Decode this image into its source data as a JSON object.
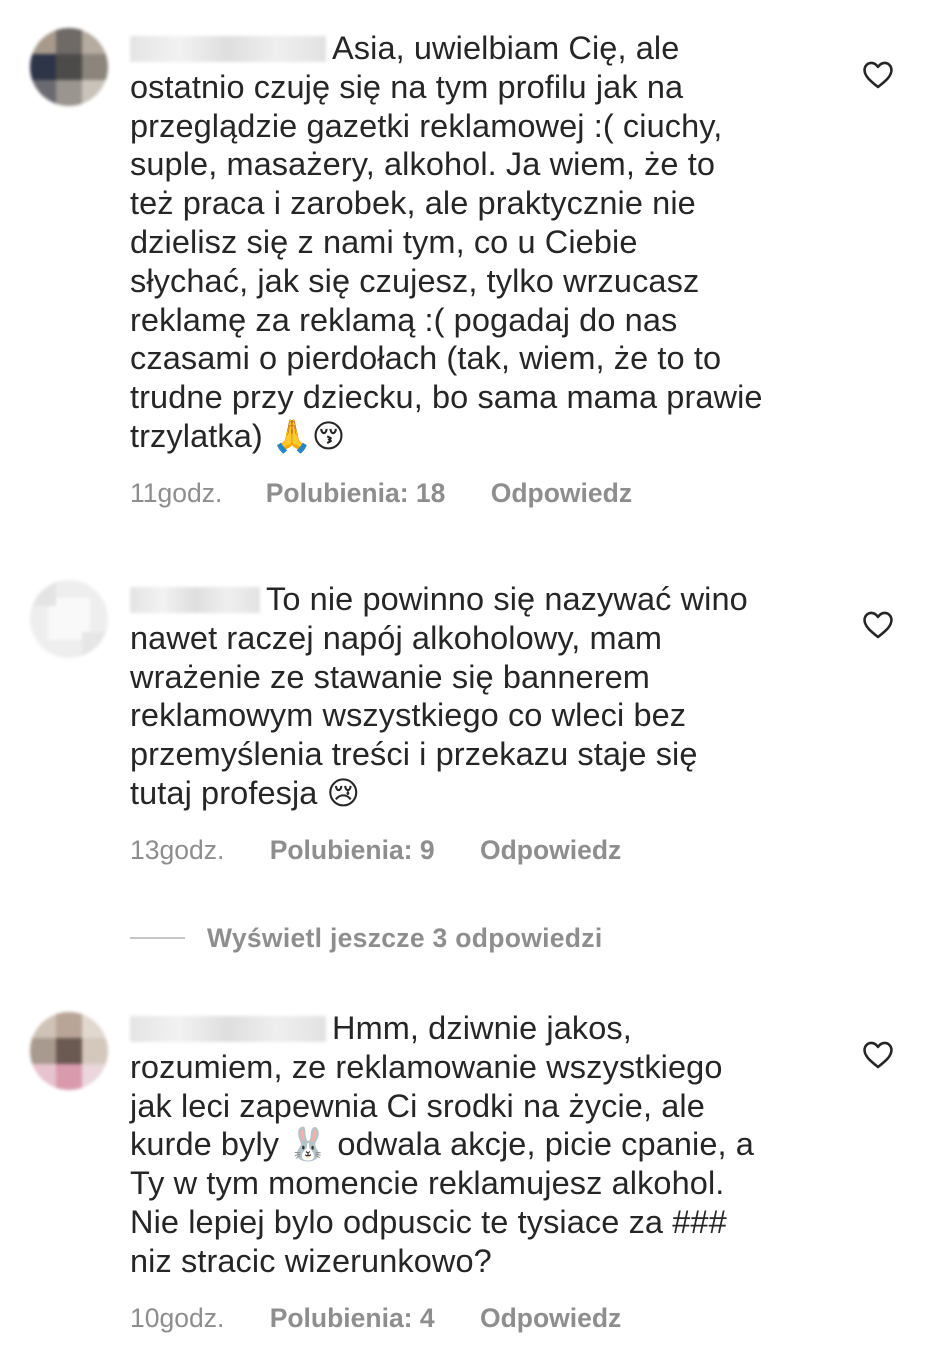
{
  "comments": [
    {
      "text": "Asia, uwielbiam Cię, ale\nostatnio czuję się na tym profilu jak na\nprzeglądzie gazetki reklamowej :( ciuchy,\nsuple, masażery, alkohol. Ja wiem, że to\nteż praca i zarobek, ale praktycznie nie\ndzielisz się z nami tym, co u Ciebie\nsłychać, jak się czujesz, tylko wrzucasz\nreklamę za reklamą :( pogadaj do nas\nczasami o pierdołach (tak, wiem, że to to\ntrudne przy dziecku, bo sama mama prawie\ntrzylatka) ",
      "emoji1": "🙏",
      "emoji2": "😚",
      "time": "11godz.",
      "likes": "Polubienia: 18",
      "reply": "Odpowiedz"
    },
    {
      "text": "To nie powinno się nazywać wino\nnawet raczej napój alkoholowy, mam\nwrażenie ze stawanie się bannerem\nreklamowym wszystkiego co wleci bez\nprzemyślenia treści i przekazu staje się\ntutaj profesja ",
      "emoji1": "😢",
      "time": "13godz.",
      "likes": "Polubienia: 9",
      "reply": "Odpowiedz"
    },
    {
      "text_a": "Hmm, dziwnie jakos,\nrozumiem, ze reklamowanie wszystkiego\njak leci zapewnia Ci srodki na życie, ale\nkurde byly ",
      "emoji1": "🐰",
      "text_b": " odwala akcje, picie cpanie, a\nTy w tym momencie reklamujesz alkohol.\nNie lepiej bylo odpuscic te tysiace za ###\nniz stracic wizerunkowo?",
      "time": "10godz.",
      "likes": "Polubienia: 4",
      "reply": "Odpowiedz"
    }
  ],
  "view_more": "Wyświetl jeszcze 3 odpowiedzi",
  "icons": {
    "like": "heart-outline-icon"
  },
  "colors": {
    "text": "#262626",
    "meta": "#8e8e8e"
  }
}
